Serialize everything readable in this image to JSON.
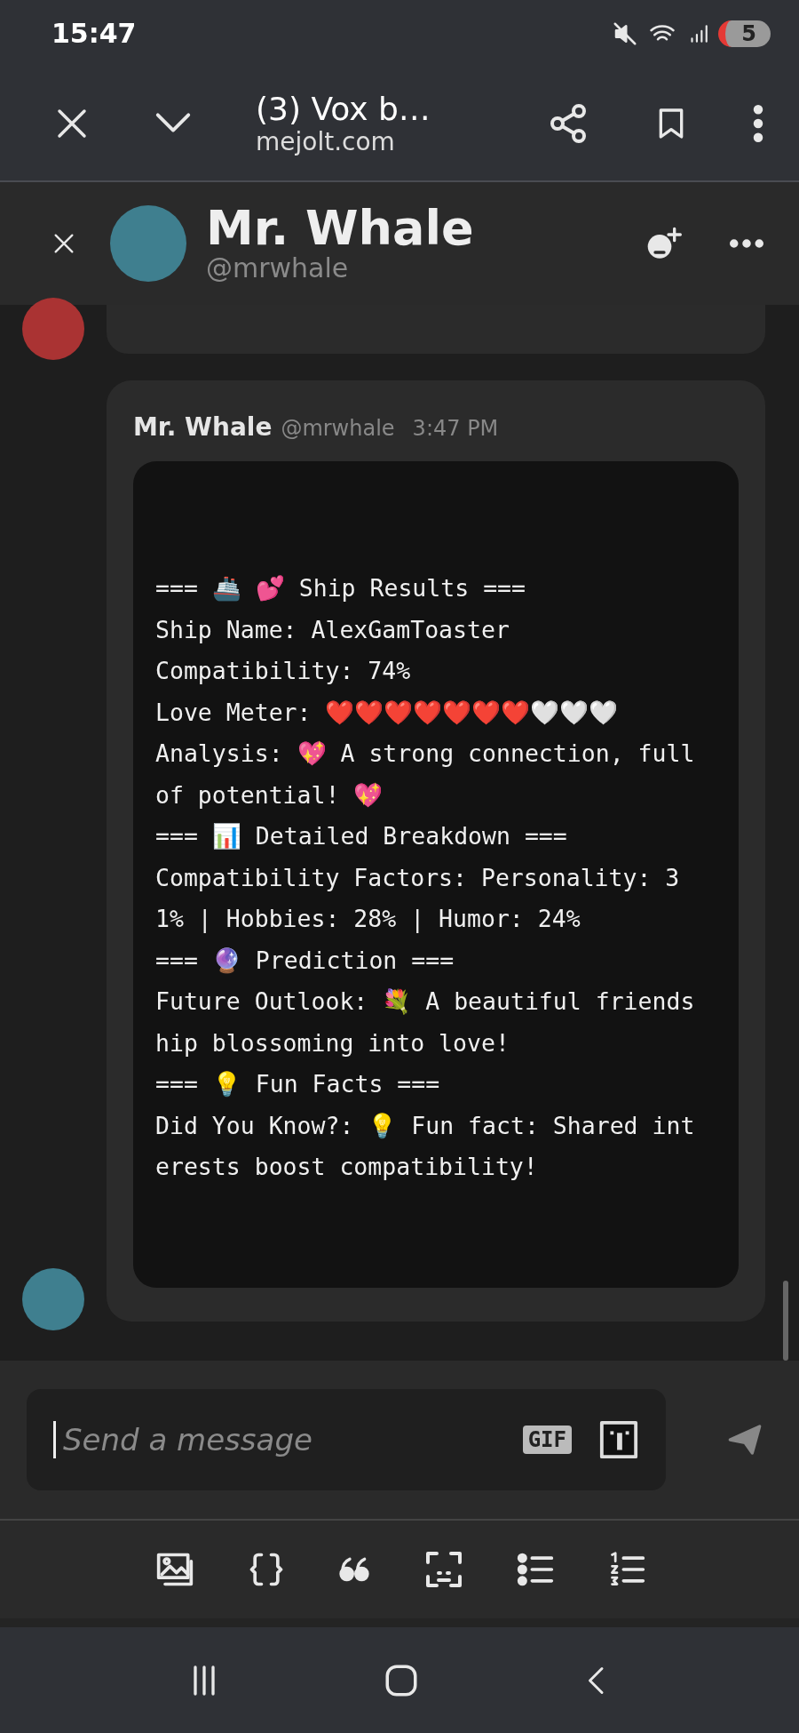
{
  "status_bar": {
    "time": "15:47",
    "battery": "5"
  },
  "browser": {
    "title": "(3) Vox b…",
    "url": "mejolt.com"
  },
  "chat_header": {
    "name": "Mr. Whale",
    "handle": "@mrwhale"
  },
  "message": {
    "author": "Mr. Whale",
    "handle": "@mrwhale",
    "time": "3:47 PM",
    "code_lines": [
      "=== 🚢 💕 Ship Results ===",
      "Ship Name: AlexGamToaster",
      "Compatibility: 74%",
      "Love Meter: ❤️❤️❤️❤️❤️❤️❤️🤍🤍🤍",
      "Analysis: 💖 A strong connection, full",
      "of potential! 💖",
      "=== 📊 Detailed Breakdown ===",
      "Compatibility Factors: Personality: 3",
      "1% | Hobbies: 28% | Humor: 24%",
      "=== 🔮 Prediction ===",
      "Future Outlook: 💐 A beautiful friends",
      "hip blossoming into love!",
      "=== 💡 Fun Facts ===",
      "Did You Know?: 💡 Fun fact: Shared int",
      "erests boost compatibility!"
    ]
  },
  "composer": {
    "placeholder": "Send a message",
    "gif": "GIF"
  }
}
